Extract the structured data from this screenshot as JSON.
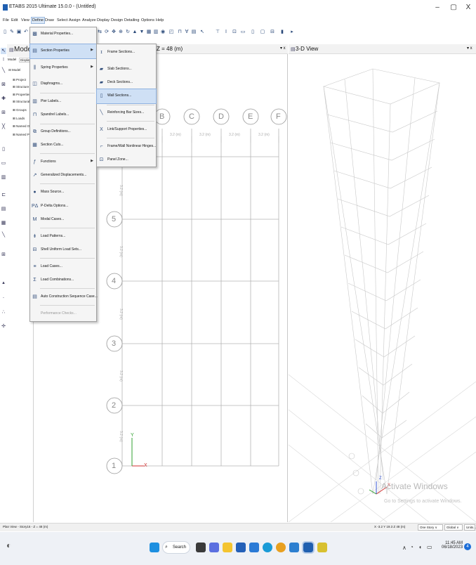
{
  "window": {
    "title": "ETABS 2015 Ultimate 15.0.0 - (Untitled)",
    "minimize_label": "–",
    "restore_label": "▢",
    "close_label": "X"
  },
  "menubar": [
    "File",
    "Edit",
    "View",
    "Define",
    "Draw",
    "Select",
    "Assign",
    "Analyze",
    "Display",
    "Design",
    "Detailing",
    "Options",
    "Help"
  ],
  "explorer": {
    "title": "Mode",
    "tabs": [
      "Model",
      "Display"
    ],
    "tree": [
      "⊟ Model",
      "⊞ Project",
      "⊞ Structure",
      "⊞ Properties",
      "⊞ Structural",
      "⊞ Groups",
      "⊞ Loads",
      "⊞ Named O",
      "⊞ Named Pl"
    ]
  },
  "define_menu": {
    "items": [
      {
        "label": "Material Properties...",
        "icon": "material-icon"
      },
      {
        "label": "Section Properties",
        "icon": "section-icon",
        "submenu": true
      },
      {
        "label": "Spring Properties",
        "icon": "spring-icon",
        "submenu": true
      },
      {
        "label": "Diaphragms...",
        "icon": "diaphragm-icon"
      },
      {
        "label": "Pier Labels...",
        "icon": "pier-icon"
      },
      {
        "label": "Spandrel Labels...",
        "icon": "spandrel-icon"
      },
      {
        "label": "Group Definitions...",
        "icon": "group-icon"
      },
      {
        "label": "Section Cuts...",
        "icon": "section-cut-icon"
      },
      {
        "label": "Functions",
        "icon": "function-icon",
        "submenu": true
      },
      {
        "label": "Generalized Displacements...",
        "icon": "displacement-icon"
      },
      {
        "label": "Mass Source...",
        "icon": "mass-icon"
      },
      {
        "label": "P-Delta Options...",
        "icon": "pdelta-icon"
      },
      {
        "label": "Modal Cases...",
        "icon": "modal-icon"
      },
      {
        "label": "Load Patterns...",
        "icon": "load-pattern-icon"
      },
      {
        "label": "Shell Uniform Load Sets...",
        "icon": "shell-load-icon"
      },
      {
        "label": "Load Cases...",
        "icon": "load-case-icon"
      },
      {
        "label": "Load Combinations...",
        "icon": "load-combo-icon"
      },
      {
        "label": "Auto Construction Sequence Case...",
        "icon": "sequence-icon"
      },
      {
        "label": "Performance Checks...",
        "icon": "",
        "disabled": true
      }
    ]
  },
  "section_submenu": {
    "items": [
      {
        "label": "Frame Sections...",
        "icon": "frame-section-icon"
      },
      {
        "label": "Slab Sections...",
        "icon": "slab-section-icon"
      },
      {
        "label": "Deck Sections...",
        "icon": "deck-section-icon"
      },
      {
        "label": "Wall Sections...",
        "icon": "wall-section-icon"
      },
      {
        "label": "Reinforcing Bar Sizes...",
        "icon": "rebar-icon"
      },
      {
        "label": "Link/Support Properties...",
        "icon": "link-icon"
      },
      {
        "label": "Frame/Wall Nonlinear Hinges...",
        "icon": "hinge-icon"
      },
      {
        "label": "Panel Zone...",
        "icon": "panel-zone-icon"
      }
    ]
  },
  "plan_view": {
    "tab_label": "Z = 48 (m)",
    "close_label": "▾ x",
    "column_grid": [
      "B",
      "C",
      "D",
      "E",
      "F"
    ],
    "row_grid": [
      "5",
      "4",
      "3",
      "2",
      "1"
    ],
    "spacing_x": "3.2 (m)",
    "spacing_y": "3.2 (m)",
    "axis_x": "X",
    "axis_y": "Y"
  },
  "view_3d": {
    "tab_label": "3-D View",
    "close_label": "▾ x",
    "watermark_title": "Activate Windows",
    "watermark_sub": "Go to Settings to activate Windows.",
    "axis_x": "X",
    "axis_z": "Z"
  },
  "statusbar": {
    "left": "Plan View - Story16 - Z = 48 (m)",
    "coords": "X -3.2  Y 19.3  Z 48 (m)",
    "story_select": "One Story",
    "coord_select": "Global",
    "units_select": "Units..."
  },
  "taskbar": {
    "search_label": "Search",
    "time": "11:45 AM",
    "date": "06/18/2023",
    "notification_count": "4"
  }
}
